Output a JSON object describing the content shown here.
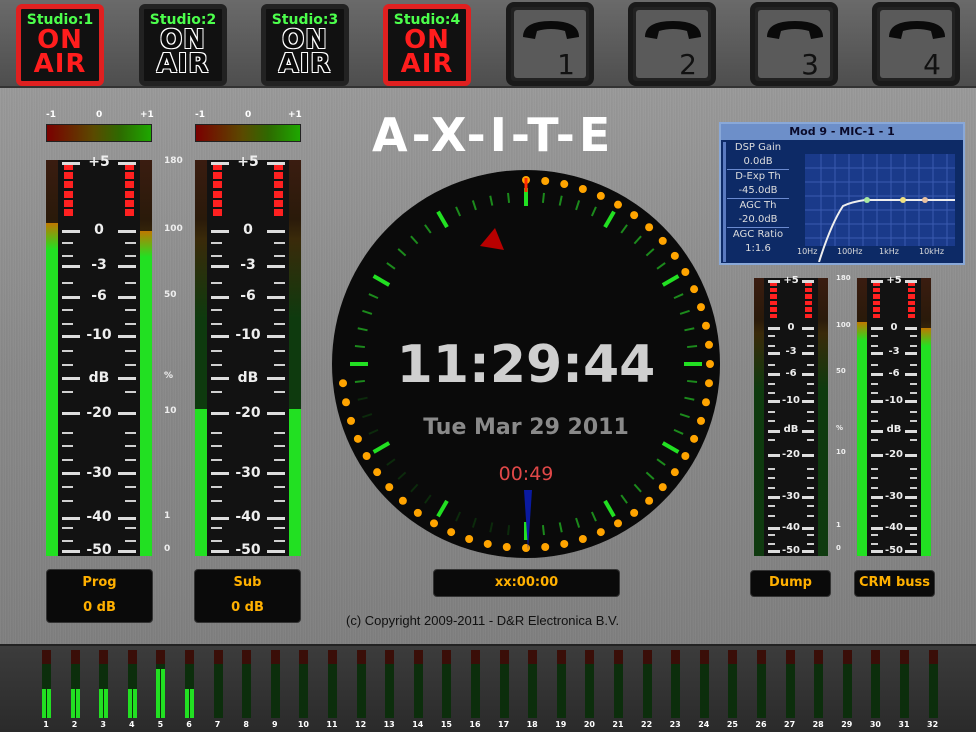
{
  "studios": [
    {
      "name": "Studio:1",
      "word1": "ON",
      "word2": "AIR",
      "on_air": true
    },
    {
      "name": "Studio:2",
      "word1": "ON",
      "word2": "AIR",
      "on_air": false
    },
    {
      "name": "Studio:3",
      "word1": "ON",
      "word2": "AIR",
      "on_air": false
    },
    {
      "name": "Studio:4",
      "word1": "ON",
      "word2": "AIR",
      "on_air": true
    }
  ],
  "phones": [
    "1",
    "2",
    "3",
    "4"
  ],
  "title": "A-X-I-T-E",
  "clock": {
    "time": "11:29:44",
    "date": "Tue Mar 29 2011",
    "timer": "00:49",
    "timecode": "xx:00:00"
  },
  "phase_labels": [
    "-1",
    "0",
    "+1"
  ],
  "meter_scale": [
    "+5",
    "0",
    "-3",
    "-6",
    "-10",
    "dB",
    "-20",
    "-30",
    "-40",
    "-50"
  ],
  "pct_scale": [
    "180",
    "100",
    "50",
    "%",
    "10",
    "1",
    "0"
  ],
  "meters": {
    "prog": {
      "name": "Prog",
      "value": "0 dB",
      "level_left": 0.84,
      "level_right": 0.82
    },
    "sub": {
      "name": "Sub",
      "value": "0 dB",
      "level_left": 0.37,
      "level_right": 0.37
    },
    "dump": {
      "name": "Dump",
      "value": "",
      "level_left": 0.0,
      "level_right": 0.0
    },
    "crm": {
      "name": "CRM buss",
      "value": "",
      "level_left": 0.84,
      "level_right": 0.82
    }
  },
  "dsp": {
    "title": "Mod 9 - MIC-1 - 1",
    "rows": [
      {
        "label": "DSP Gain",
        "value": "0.0dB"
      },
      {
        "label": "D-Exp Th",
        "value": "-45.0dB"
      },
      {
        "label": "AGC Th",
        "value": "-20.0dB"
      },
      {
        "label": "AGC Ratio",
        "value": "1:1.6"
      }
    ],
    "freq_labels": [
      "10Hz",
      "100Hz",
      "1kHz",
      "10kHz"
    ]
  },
  "copyright": "(c) Copyright 2009-2011 - D&R Electronica  B.V.",
  "channels": {
    "numbers": [
      "1",
      "2",
      "3",
      "4",
      "5",
      "6",
      "7",
      "8",
      "9",
      "10",
      "11",
      "12",
      "13",
      "14",
      "15",
      "16",
      "17",
      "18",
      "19",
      "20",
      "21",
      "22",
      "23",
      "24",
      "25",
      "26",
      "27",
      "28",
      "29",
      "30",
      "31",
      "32"
    ],
    "levels": [
      0.42,
      0.42,
      0.42,
      0.42,
      0.72,
      0.42,
      0,
      0,
      0,
      0,
      0,
      0,
      0,
      0,
      0,
      0,
      0,
      0,
      0,
      0,
      0,
      0,
      0,
      0,
      0,
      0,
      0,
      0,
      0,
      0,
      0,
      0
    ]
  },
  "colors": {
    "on_air": "#ff1d1d",
    "studio_label": "#4cff4c",
    "meter_green": "#22e022",
    "label_text": "#ffb000"
  }
}
